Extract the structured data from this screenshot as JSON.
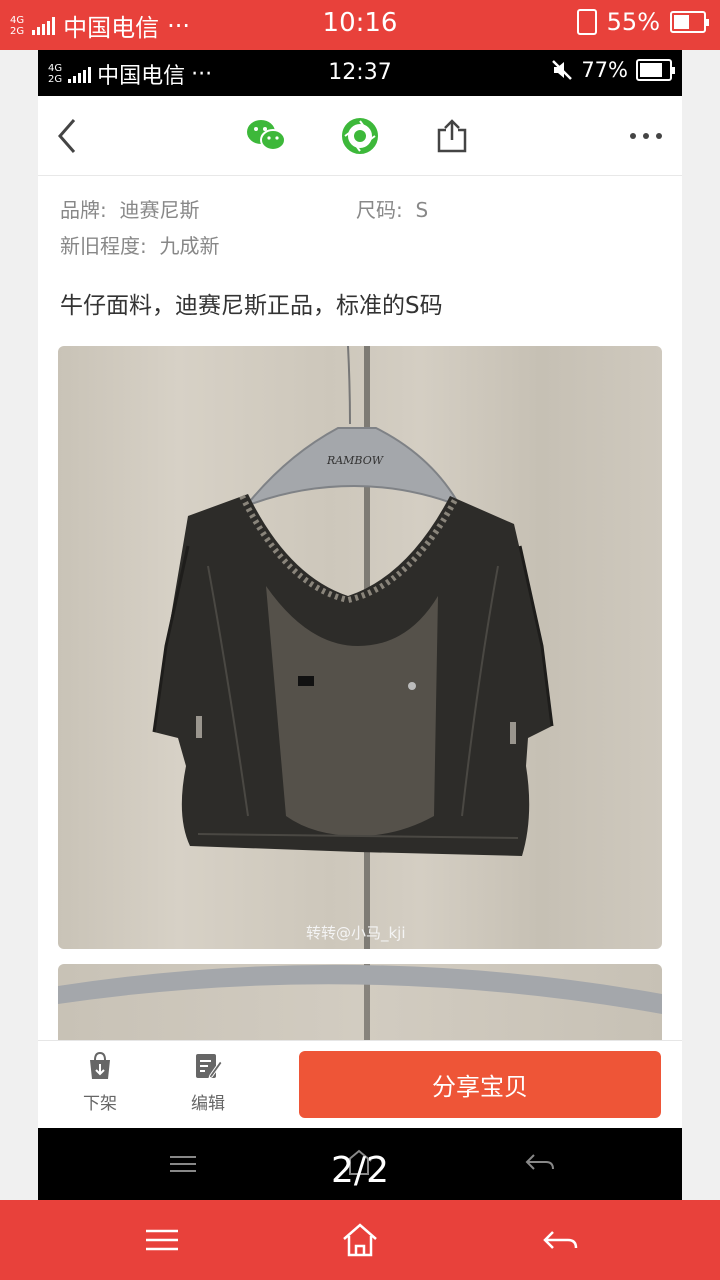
{
  "outer_status": {
    "network_badge_top": "4G",
    "network_badge_bottom": "2G",
    "carrier": "中国电信",
    "dots": "···",
    "time": "10:16",
    "battery": "55%",
    "battery_level": 0.55
  },
  "inner_status": {
    "network_badge_top": "4G",
    "network_badge_bottom": "2G",
    "carrier": "中国电信",
    "dots": "···",
    "time": "12:37",
    "battery": "77%",
    "battery_level": 0.77
  },
  "header": {
    "icons": [
      "back-icon",
      "wechat-icon",
      "moments-icon",
      "share-icon",
      "more-icon"
    ],
    "accent_color": "#3db83a"
  },
  "item": {
    "brand_label": "品牌:",
    "brand_value": "迪赛尼斯",
    "size_label": "尺码:",
    "size_value": "S",
    "condition_label": "新旧程度:",
    "condition_value": "九成新",
    "description": "牛仔面料，迪赛尼斯正品，标准的S码",
    "watermark": "转转@小马_kji",
    "hanger_brand": "RAMBOW"
  },
  "actions": {
    "delist_label": "下架",
    "edit_label": "编辑",
    "share_label": "分享宝贝",
    "share_color": "#ee5537"
  },
  "inner_nav": {
    "page_counter": "2/2"
  },
  "colors": {
    "status_bar": "#e8413b"
  }
}
